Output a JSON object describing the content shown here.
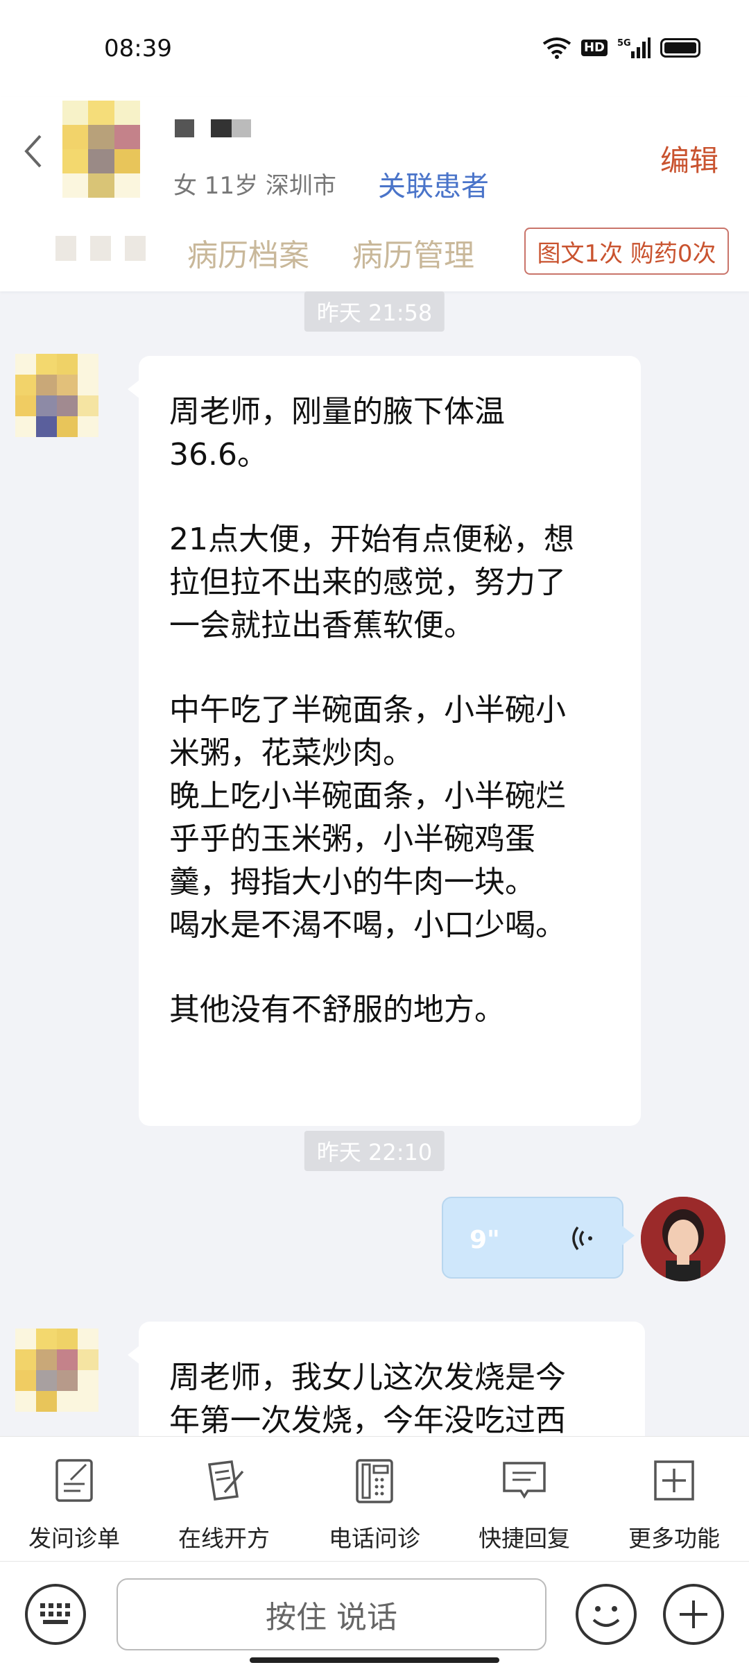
{
  "status_bar": {
    "time": "08:39",
    "hd_label": "HD",
    "network_label": "5G"
  },
  "header": {
    "patient_info": "女 11岁  深圳市",
    "link_patient": "关联患者",
    "edit": "编辑",
    "tabs": [
      "病历档案",
      "病历管理"
    ],
    "quota": "图文1次 购药0次"
  },
  "chat": {
    "timestamps": [
      "昨天 21:58",
      "昨天 22:10"
    ],
    "messages": [
      {
        "paragraphs": [
          "周老师，刚量的腋下体温\n36.6。",
          "21点大便，开始有点便秘，想\n拉但拉不出来的感觉，努力了\n一会就拉出香蕉软便。",
          "中午吃了半碗面条，小半碗小\n米粥，花菜炒肉。\n晚上吃小半碗面条，小半碗烂\n乎乎的玉米粥，小半碗鸡蛋\n羹，拇指大小的牛肉一块。\n喝水是不渴不喝，小口少喝。",
          "其他没有不舒服的地方。"
        ]
      },
      {
        "paragraphs": [
          "周老师，我女儿这次发烧是今\n年第一次发烧，今年没吃过西"
        ]
      }
    ],
    "voice_message": {
      "duration": "9\""
    }
  },
  "toolbar": {
    "items": [
      {
        "label": "发问诊单",
        "icon": "form-icon"
      },
      {
        "label": "在线开方",
        "icon": "prescription-icon"
      },
      {
        "label": "电话问诊",
        "icon": "phone-icon"
      },
      {
        "label": "快捷回复",
        "icon": "quick-reply-icon"
      },
      {
        "label": "更多功能",
        "icon": "plus-square-icon"
      }
    ]
  },
  "input_bar": {
    "hold_to_talk": "按住 说话"
  }
}
